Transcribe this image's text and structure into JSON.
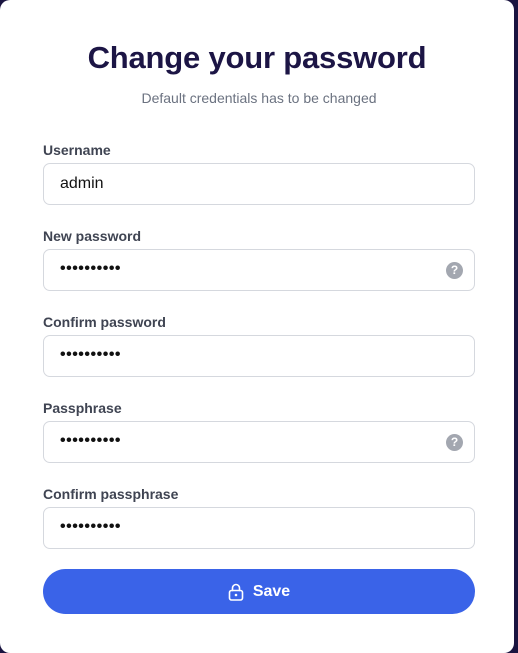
{
  "form": {
    "title": "Change your password",
    "subtitle": "Default credentials has to be changed",
    "fields": [
      {
        "label": "Username",
        "value": "admin",
        "masked": false
      },
      {
        "label": "New password",
        "value": "••••••••••",
        "masked": true,
        "help_icon": "question-circle-icon"
      },
      {
        "label": "Confirm password",
        "value": "••••••••••",
        "masked": true
      },
      {
        "label": "Passphrase",
        "value": "••••••••••",
        "masked": true,
        "help_icon": "question-circle-icon"
      },
      {
        "label": "Confirm passphrase",
        "value": "••••••••••",
        "masked": true
      }
    ],
    "help_glyph": "?",
    "save_label": "Save",
    "save_icon": "lock-icon"
  },
  "colors": {
    "primary": "#3a63e8",
    "title": "#1c1545",
    "background": "#1a1440"
  }
}
